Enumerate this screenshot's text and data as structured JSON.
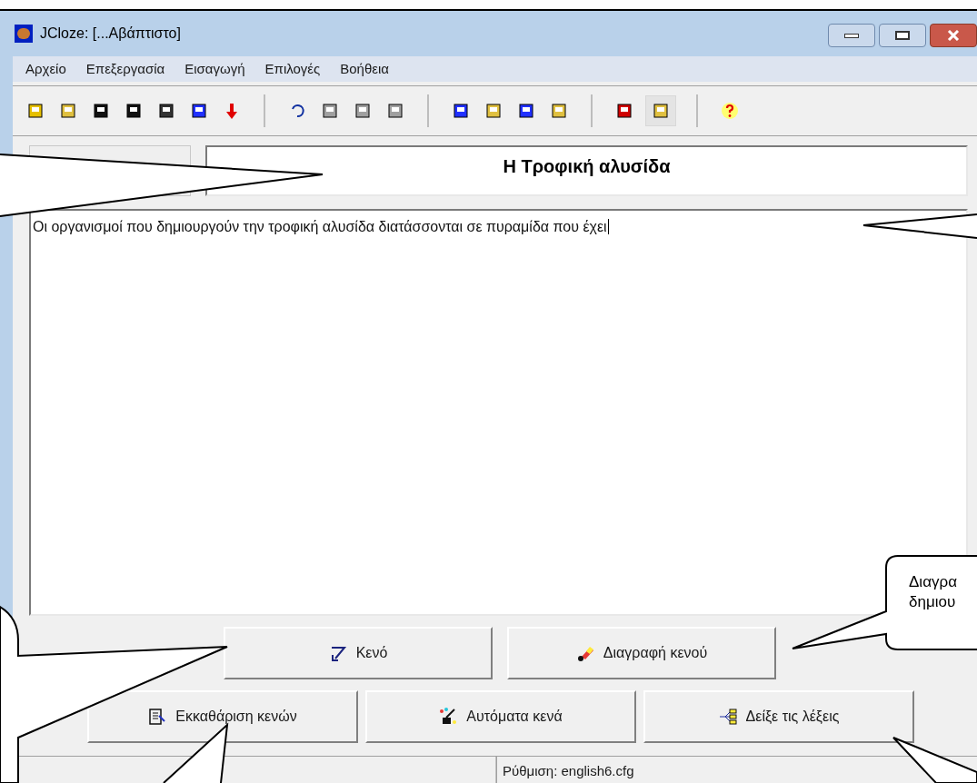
{
  "window": {
    "title": "JCloze: [...Αβάπτιστο]"
  },
  "menu": [
    "Αρχείο",
    "Επεξεργασία",
    "Εισαγωγή",
    "Επιλογές",
    "Βοήθεια"
  ],
  "toolbar": [
    [
      {
        "disabled": false,
        "pressed": false
      },
      {
        "disabled": false,
        "pressed": false
      },
      {
        "disabled": false,
        "pressed": false
      },
      {
        "disabled": false,
        "pressed": false
      },
      {
        "disabled": false,
        "pressed": false
      },
      {
        "disabled": false,
        "pressed": false
      },
      {
        "disabled": false,
        "pressed": false
      }
    ],
    [
      {
        "disabled": false,
        "pressed": false
      },
      {
        "disabled": true,
        "pressed": false
      },
      {
        "disabled": true,
        "pressed": false
      },
      {
        "disabled": true,
        "pressed": false
      }
    ],
    [
      {
        "disabled": false,
        "pressed": false
      },
      {
        "disabled": false,
        "pressed": false
      },
      {
        "disabled": false,
        "pressed": false
      },
      {
        "disabled": false,
        "pressed": false
      }
    ],
    [
      {
        "disabled": false,
        "pressed": false
      },
      {
        "disabled": false,
        "pressed": true
      }
    ],
    [
      {
        "disabled": false,
        "pressed": false
      }
    ]
  ],
  "title_field": {
    "value": "Η Τροφική αλυσίδα"
  },
  "text_area": {
    "value": "Οι οργανισμοί που δημιουργούν την τροφική αλυσίδα διατάσσονται σε πυραμίδα που έχει"
  },
  "buttons": [
    [
      "Κενό",
      "Διαγραφή κενού"
    ],
    [
      "Εκκαθάριση κενών",
      "Αυτόματα κενά",
      "Δείξε τις λέξεις"
    ]
  ],
  "status_bar": [
    "Ρύθμιση: english6.cfg"
  ],
  "callout": {
    "lines": [
      "Διαγρα",
      "δημιου"
    ]
  }
}
